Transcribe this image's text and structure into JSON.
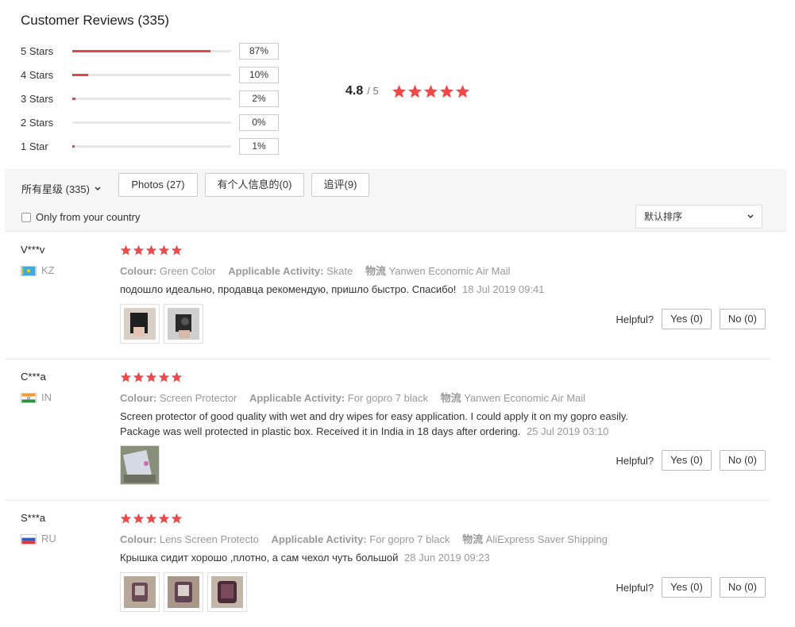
{
  "title": "Customer Reviews (335)",
  "distribution": [
    {
      "label": "5 Stars",
      "pct": "87%",
      "value": 87
    },
    {
      "label": "4 Stars",
      "pct": "10%",
      "value": 10
    },
    {
      "label": "3 Stars",
      "pct": "2%",
      "value": 2
    },
    {
      "label": "2 Stars",
      "pct": "0%",
      "value": 0
    },
    {
      "label": "1 Star",
      "pct": "1%",
      "value": 1
    }
  ],
  "average": {
    "value": "4.8",
    "of": "/ 5",
    "stars": 5
  },
  "filters": {
    "all_ratings": "所有星级 (335)",
    "photos": "Photos (27)",
    "personal_info": "有个人信息的(0)",
    "followup": "追评(9)",
    "country_only": "Only from your country",
    "sort": "默认排序"
  },
  "labels": {
    "colour": "Colour:",
    "activity": "Applicable Activity:",
    "shipping": "物流",
    "helpful": "Helpful?"
  },
  "reviews": [
    {
      "user": "V***v",
      "country": "KZ",
      "stars": 5,
      "colour": "Green Color",
      "activity": "Skate",
      "shipping": "Yanwen Economic Air Mail",
      "text": "подошло идеально, продавца рекомендую, пришло быстро. Спасибо!",
      "date": "18 Jul 2019 09:41",
      "photos": 2,
      "yes": "Yes (0)",
      "no": "No (0)"
    },
    {
      "user": "C***a",
      "country": "IN",
      "stars": 5,
      "colour": "Screen Protector",
      "activity": "For gopro 7 black",
      "shipping": "Yanwen Economic Air Mail",
      "text": "Screen protector of good quality with wet and dry wipes for easy application. I could apply it on my gopro easily. Package was well protected in plastic box. Received it in India in 18 days after ordering.",
      "date": "25 Jul 2019 03:10",
      "photos": 1,
      "yes": "Yes (0)",
      "no": "No (0)"
    },
    {
      "user": "S***a",
      "country": "RU",
      "stars": 5,
      "colour": "Lens Screen Protecto",
      "activity": "For gopro 7 black",
      "shipping": "AliExpress Saver Shipping",
      "text": "Крышка сидит хорошо ,плотно, а сам чехол чуть большой",
      "date": "28 Jun 2019 09:23",
      "photos": 3,
      "yes": "Yes (0)",
      "no": "No (0)"
    }
  ],
  "colors": {
    "accent": "#e64545",
    "star": "#f04848",
    "muted": "#999999"
  }
}
